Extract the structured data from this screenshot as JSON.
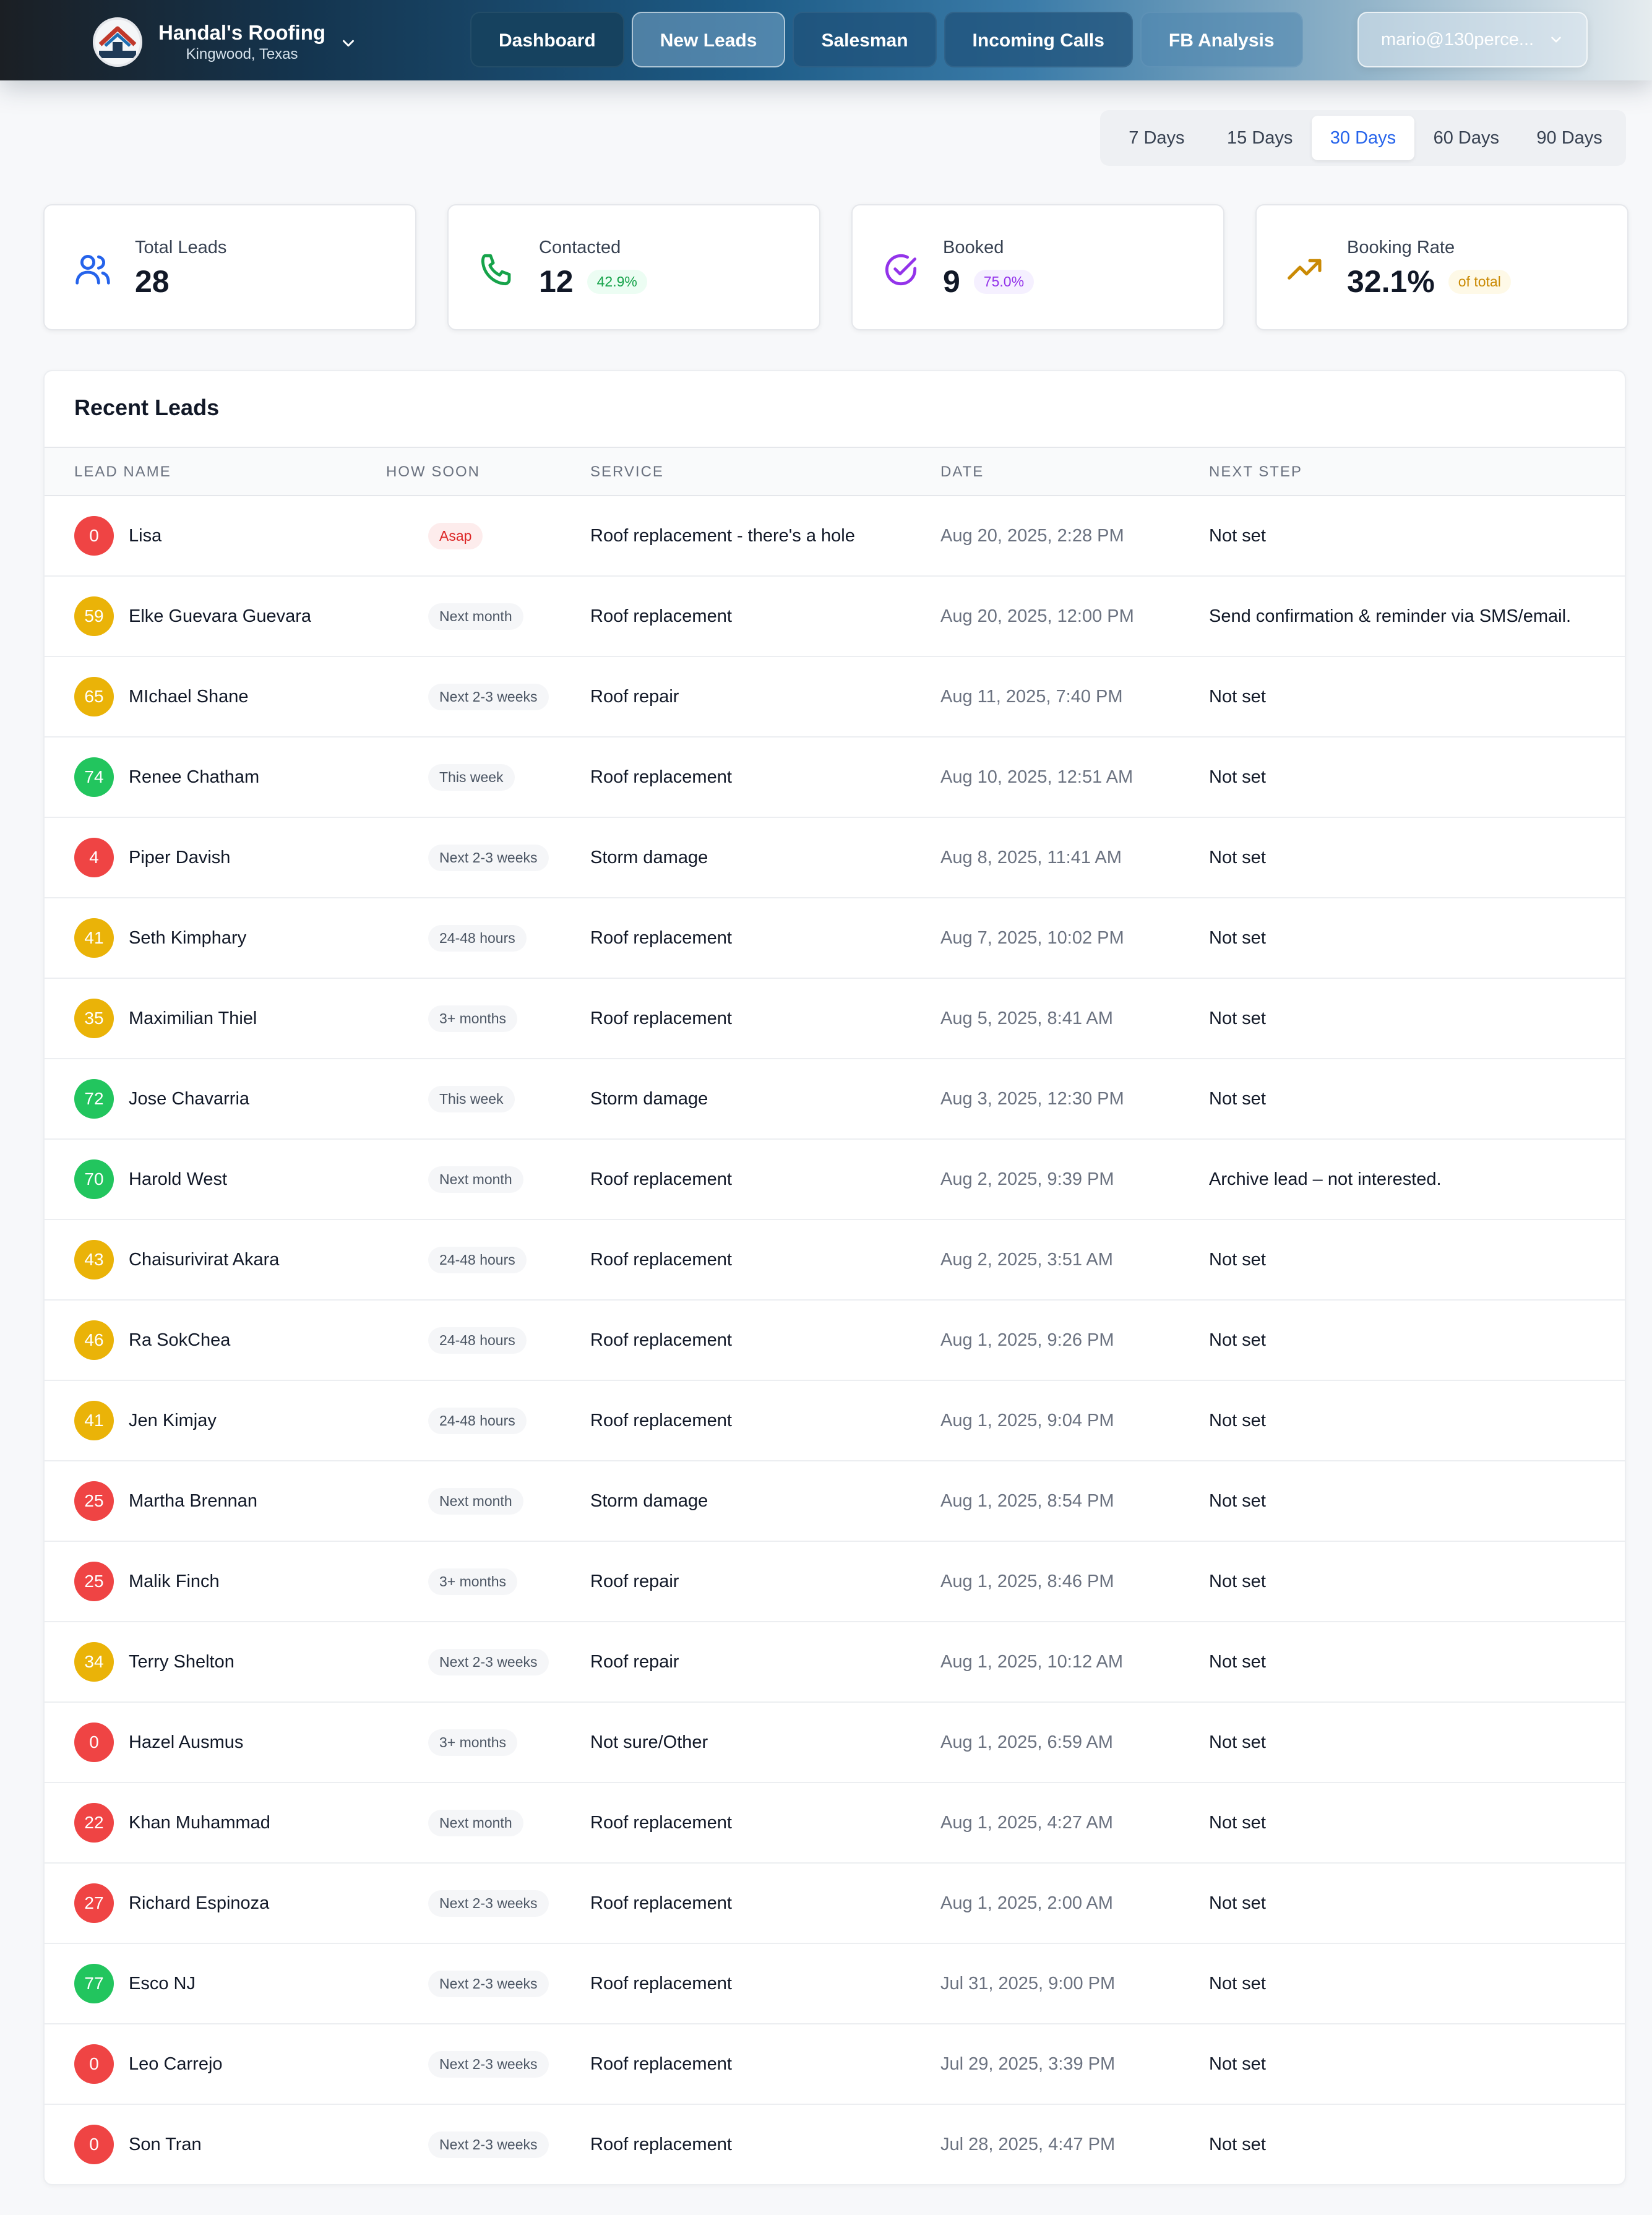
{
  "brand": {
    "name": "Handal's Roofing",
    "location": "Kingwood, Texas",
    "logo_icon": "roof-logo"
  },
  "nav": [
    {
      "label": "Dashboard",
      "state": "default"
    },
    {
      "label": "New Leads",
      "state": "active"
    },
    {
      "label": "Salesman",
      "state": "default"
    },
    {
      "label": "Incoming Calls",
      "state": "default"
    },
    {
      "label": "FB Analysis",
      "state": "default"
    }
  ],
  "account": {
    "email": "mario@130perce...",
    "icon": "chevron-down-icon"
  },
  "range_tabs": {
    "items": [
      "7 Days",
      "15 Days",
      "30 Days",
      "60 Days",
      "90 Days"
    ],
    "selected": "30 Days"
  },
  "stats": {
    "total": {
      "label": "Total Leads",
      "value": "28",
      "icon": "users-icon"
    },
    "contacted": {
      "label": "Contacted",
      "value": "12",
      "badge": "42.9%",
      "icon": "phone-icon"
    },
    "booked": {
      "label": "Booked",
      "value": "9",
      "badge": "75.0%",
      "icon": "check-circle-icon"
    },
    "rate": {
      "label": "Booking Rate",
      "value": "32.1%",
      "badge": "of total",
      "icon": "trending-up-icon"
    }
  },
  "colors": {
    "red": "#ef4444",
    "yellow": "#eab308",
    "green": "#22c55e",
    "accent": "#2563eb"
  },
  "table": {
    "title": "Recent Leads",
    "columns": [
      "LEAD NAME",
      "HOW SOON",
      "SERVICE",
      "DATE",
      "NEXT STEP"
    ],
    "rows": [
      {
        "score": "0",
        "color": "red",
        "name": "Lisa",
        "soon": "Asap",
        "service": "Roof replacement - there's a hole",
        "date": "Aug 20, 2025, 2:28 PM",
        "next": "Not set"
      },
      {
        "score": "59",
        "color": "yellow",
        "name": "Elke Guevara Guevara",
        "soon": "Next month",
        "service": "Roof replacement",
        "date": "Aug 20, 2025, 12:00 PM",
        "next": "Send confirmation & reminder via SMS/email."
      },
      {
        "score": "65",
        "color": "yellow",
        "name": "MIchael Shane",
        "soon": "Next 2-3 weeks",
        "service": "Roof repair",
        "date": "Aug 11, 2025, 7:40 PM",
        "next": "Not set"
      },
      {
        "score": "74",
        "color": "green",
        "name": "Renee Chatham",
        "soon": "This week",
        "service": "Roof replacement",
        "date": "Aug 10, 2025, 12:51 AM",
        "next": "Not set"
      },
      {
        "score": "4",
        "color": "red",
        "name": "Piper Davish",
        "soon": "Next 2-3 weeks",
        "service": "Storm damage",
        "date": "Aug 8, 2025, 11:41 AM",
        "next": "Not set"
      },
      {
        "score": "41",
        "color": "yellow",
        "name": "Seth Kimphary",
        "soon": "24-48 hours",
        "service": "Roof replacement",
        "date": "Aug 7, 2025, 10:02 PM",
        "next": "Not set"
      },
      {
        "score": "35",
        "color": "yellow",
        "name": "Maximilian Thiel",
        "soon": "3+ months",
        "service": "Roof replacement",
        "date": "Aug 5, 2025, 8:41 AM",
        "next": "Not set"
      },
      {
        "score": "72",
        "color": "green",
        "name": "Jose Chavarria",
        "soon": "This week",
        "service": "Storm damage",
        "date": "Aug 3, 2025, 12:30 PM",
        "next": "Not set"
      },
      {
        "score": "70",
        "color": "green",
        "name": "Harold West",
        "soon": "Next month",
        "service": "Roof replacement",
        "date": "Aug 2, 2025, 9:39 PM",
        "next": "Archive lead – not interested."
      },
      {
        "score": "43",
        "color": "yellow",
        "name": "Chaisurivirat Akara",
        "soon": "24-48 hours",
        "service": "Roof replacement",
        "date": "Aug 2, 2025, 3:51 AM",
        "next": "Not set"
      },
      {
        "score": "46",
        "color": "yellow",
        "name": "Ra SokChea",
        "soon": "24-48 hours",
        "service": "Roof replacement",
        "date": "Aug 1, 2025, 9:26 PM",
        "next": "Not set"
      },
      {
        "score": "41",
        "color": "yellow",
        "name": "Jen Kimjay",
        "soon": "24-48 hours",
        "service": "Roof replacement",
        "date": "Aug 1, 2025, 9:04 PM",
        "next": "Not set"
      },
      {
        "score": "25",
        "color": "red",
        "name": "Martha Brennan",
        "soon": "Next month",
        "service": "Storm damage",
        "date": "Aug 1, 2025, 8:54 PM",
        "next": "Not set"
      },
      {
        "score": "25",
        "color": "red",
        "name": "Malik Finch",
        "soon": "3+ months",
        "service": "Roof repair",
        "date": "Aug 1, 2025, 8:46 PM",
        "next": "Not set"
      },
      {
        "score": "34",
        "color": "yellow",
        "name": "Terry Shelton",
        "soon": "Next 2-3 weeks",
        "service": "Roof repair",
        "date": "Aug 1, 2025, 10:12 AM",
        "next": "Not set"
      },
      {
        "score": "0",
        "color": "red",
        "name": "Hazel Ausmus",
        "soon": "3+ months",
        "service": "Not sure/Other",
        "date": "Aug 1, 2025, 6:59 AM",
        "next": "Not set"
      },
      {
        "score": "22",
        "color": "red",
        "name": "Khan Muhammad",
        "soon": "Next month",
        "service": "Roof replacement",
        "date": "Aug 1, 2025, 4:27 AM",
        "next": "Not set"
      },
      {
        "score": "27",
        "color": "red",
        "name": "Richard Espinoza",
        "soon": "Next 2-3 weeks",
        "service": "Roof replacement",
        "date": "Aug 1, 2025, 2:00 AM",
        "next": "Not set"
      },
      {
        "score": "77",
        "color": "green",
        "name": "Esco NJ",
        "soon": "Next 2-3 weeks",
        "service": "Roof replacement",
        "date": "Jul 31, 2025, 9:00 PM",
        "next": "Not set"
      },
      {
        "score": "0",
        "color": "red",
        "name": "Leo Carrejo",
        "soon": "Next 2-3 weeks",
        "service": "Roof replacement",
        "date": "Jul 29, 2025, 3:39 PM",
        "next": "Not set"
      },
      {
        "score": "0",
        "color": "red",
        "name": "Son Tran",
        "soon": "Next 2-3 weeks",
        "service": "Roof replacement",
        "date": "Jul 28, 2025, 4:47 PM",
        "next": "Not set"
      }
    ]
  }
}
